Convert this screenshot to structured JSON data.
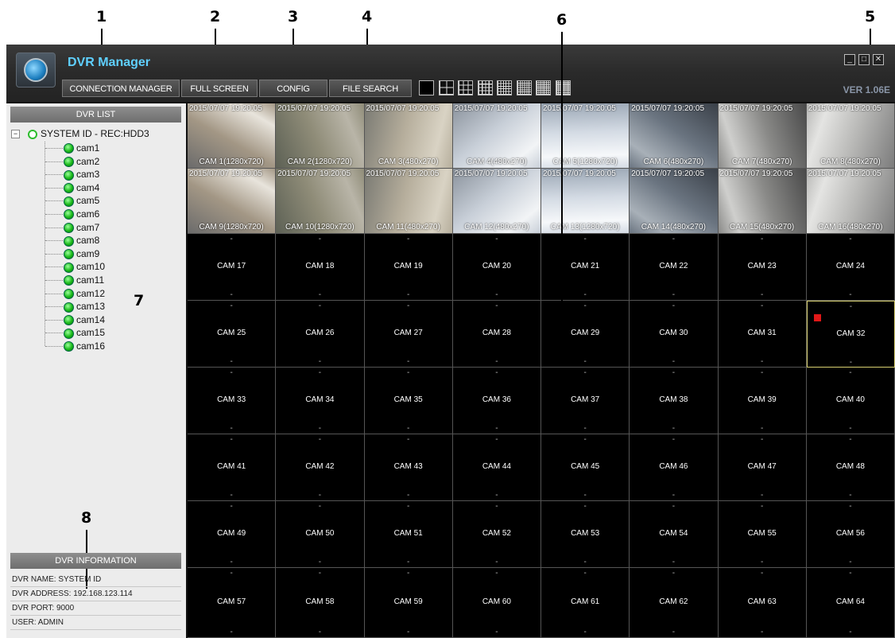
{
  "callouts": [
    "1",
    "2",
    "3",
    "4",
    "5",
    "6",
    "7",
    "8"
  ],
  "header": {
    "title": "DVR Manager",
    "version": "VER 1.06E",
    "buttons": {
      "connection_manager": "CONNECTION MANAGER",
      "full_screen": "FULL SCREEN",
      "config": "CONFIG",
      "file_search": "FILE SEARCH"
    },
    "layout_icons": [
      "layout-1x1-icon",
      "layout-2x2-icon",
      "layout-3x3-icon",
      "layout-4x4-icon",
      "layout-5x5-icon",
      "layout-6x6-icon",
      "layout-7x7-icon",
      "layout-8x8-icon"
    ],
    "window_controls": {
      "minimize": "_",
      "restore": "□",
      "close": "✕"
    }
  },
  "dvr_list": {
    "title": "DVR LIST",
    "root": "SYSTEM ID - REC:HDD3",
    "cameras": [
      "cam1",
      "cam2",
      "cam3",
      "cam4",
      "cam5",
      "cam6",
      "cam7",
      "cam8",
      "cam9",
      "cam10",
      "cam11",
      "cam12",
      "cam13",
      "cam14",
      "cam15",
      "cam16"
    ]
  },
  "dvr_information": {
    "title": "DVR INFORMATION",
    "name": "DVR NAME: SYSTEM ID",
    "address": "DVR ADDRESS: 192.168.123.114",
    "port": "DVR PORT: 9000",
    "user": "USER: ADMIN"
  },
  "video": {
    "timestamp": "2015/07/07  19:20:05",
    "feeds": [
      "CAM 1(1280x720)",
      "CAM 2(1280x720)",
      "CAM 3(480x270)",
      "CAM 4(480x270)",
      "CAM 5(1280x720)",
      "CAM 6(480x270)",
      "CAM 7(480x270)",
      "CAM 8(480x270)",
      "CAM 9(1280x720)",
      "CAM 10(1280x720)",
      "CAM 11(480x270)",
      "CAM 12(480x270)",
      "CAM 13(1280x720)",
      "CAM 14(480x270)",
      "CAM 15(480x270)",
      "CAM 16(480x270)"
    ],
    "empty_cells": [
      "CAM 17",
      "CAM 18",
      "CAM 19",
      "CAM 20",
      "CAM 21",
      "CAM 22",
      "CAM 23",
      "CAM 24",
      "CAM 25",
      "CAM 26",
      "CAM 27",
      "CAM 28",
      "CAM 29",
      "CAM 30",
      "CAM 31",
      "CAM 32",
      "CAM 33",
      "CAM 34",
      "CAM 35",
      "CAM 36",
      "CAM 37",
      "CAM 38",
      "CAM 39",
      "CAM 40",
      "CAM 41",
      "CAM 42",
      "CAM 43",
      "CAM 44",
      "CAM 45",
      "CAM 46",
      "CAM 47",
      "CAM 48",
      "CAM 49",
      "CAM 50",
      "CAM 51",
      "CAM 52",
      "CAM 53",
      "CAM 54",
      "CAM 55",
      "CAM 56",
      "CAM 57",
      "CAM 58",
      "CAM 59",
      "CAM 60",
      "CAM 61",
      "CAM 62",
      "CAM 63",
      "CAM 64"
    ],
    "placeholder_dash": "-",
    "selected_cell": "CAM 32",
    "alarm_cell": "CAM 32"
  },
  "colors": {
    "title_accent": "#5fd0ff",
    "status_green": "#19b919",
    "selection": "#d8d070",
    "alarm": "#e01818"
  }
}
